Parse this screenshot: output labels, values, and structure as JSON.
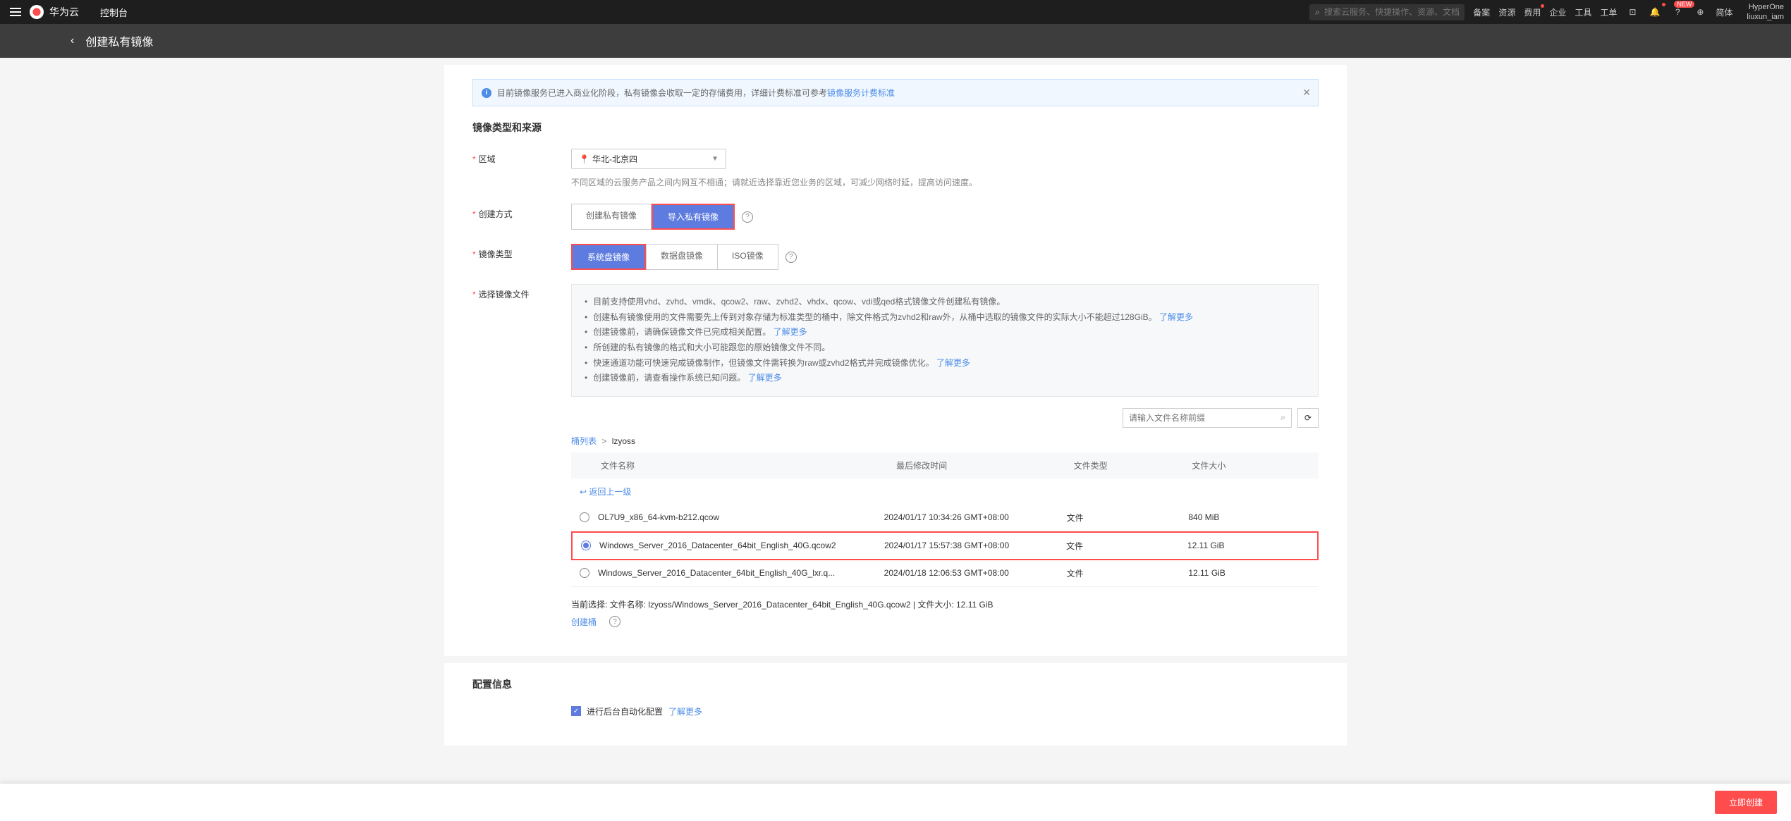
{
  "header": {
    "brand": "华为云",
    "console": "控制台",
    "search_placeholder": "搜索云服务、快捷操作、资源、文档、API",
    "nav": [
      "备案",
      "资源",
      "费用",
      "企业",
      "工具",
      "工单"
    ],
    "lang": "简体",
    "new_badge": "NEW",
    "user": {
      "name": "HyperOne",
      "account": "liuxun_iam"
    }
  },
  "page": {
    "title": "创建私有镜像"
  },
  "banner": {
    "text": "目前镜像服务已进入商业化阶段，私有镜像会收取一定的存储费用，详细计费标准可参考",
    "link": "镜像服务计费标准"
  },
  "section1": {
    "title": "镜像类型和来源",
    "region": {
      "label": "区域",
      "value": "华北-北京四",
      "hint": "不同区域的云服务产品之间内网互不相通；请就近选择靠近您业务的区域，可减少网络时延，提高访问速度。"
    },
    "create_method": {
      "label": "创建方式",
      "options": [
        "创建私有镜像",
        "导入私有镜像"
      ],
      "active": 1
    },
    "image_type": {
      "label": "镜像类型",
      "options": [
        "系统盘镜像",
        "数据盘镜像",
        "ISO镜像"
      ],
      "active": 0
    },
    "select_file": {
      "label": "选择镜像文件",
      "info_items": [
        {
          "text": "目前支持使用vhd、zvhd、vmdk、qcow2、raw、zvhd2、vhdx、qcow、vdi或qed格式镜像文件创建私有镜像。"
        },
        {
          "text": "创建私有镜像使用的文件需要先上传到对象存储为标准类型的桶中，除文件格式为zvhd2和raw外，从桶中选取的镜像文件的实际大小不能超过128GiB。",
          "link": "了解更多"
        },
        {
          "text": "创建镜像前，请确保镜像文件已完成相关配置。",
          "link": "了解更多"
        },
        {
          "text": "所创建的私有镜像的格式和大小可能跟您的原始镜像文件不同。"
        },
        {
          "text": "快速通道功能可快速完成镜像制作，但镜像文件需转换为raw或zvhd2格式并完成镜像优化。",
          "link": "了解更多"
        },
        {
          "text": "创建镜像前，请查看操作系统已知问题。",
          "link": "了解更多"
        }
      ],
      "search_placeholder": "请输入文件名称前缀",
      "breadcrumb": {
        "root": "桶列表",
        "current": "lzyoss"
      },
      "table": {
        "headers": [
          "文件名称",
          "最后修改时间",
          "文件类型",
          "文件大小"
        ],
        "back_link": "返回上一级",
        "rows": [
          {
            "name": "OL7U9_x86_64-kvm-b212.qcow",
            "time": "2024/01/17 10:34:26 GMT+08:00",
            "type": "文件",
            "size": "840 MiB",
            "selected": false
          },
          {
            "name": "Windows_Server_2016_Datacenter_64bit_English_40G.qcow2",
            "time": "2024/01/17 15:57:38 GMT+08:00",
            "type": "文件",
            "size": "12.11 GiB",
            "selected": true
          },
          {
            "name": "Windows_Server_2016_Datacenter_64bit_English_40G_lxr.q...",
            "time": "2024/01/18 12:06:53 GMT+08:00",
            "type": "文件",
            "size": "12.11 GiB",
            "selected": false
          }
        ]
      },
      "selection_text": "当前选择: 文件名称:  lzyoss/Windows_Server_2016_Datacenter_64bit_English_40G.qcow2 | 文件大小:  12.11 GiB",
      "create_bucket": "创建桶"
    }
  },
  "section2": {
    "title": "配置信息",
    "auto_config": {
      "label": "进行后台自动化配置",
      "link": "了解更多"
    }
  },
  "submit": "立即创建"
}
